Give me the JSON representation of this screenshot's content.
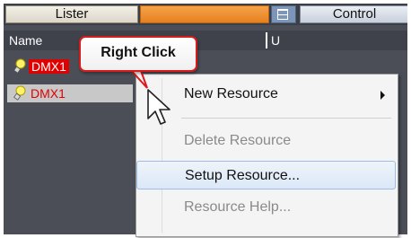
{
  "tabs": {
    "lister": "Lister",
    "control": "Control"
  },
  "columns": {
    "name": "Name",
    "u": "U"
  },
  "rows": [
    {
      "label": "DMX1"
    },
    {
      "label": "DMX1"
    }
  ],
  "menu": {
    "new_resource": "New Resource",
    "delete_resource": "Delete Resource",
    "setup_resource": "Setup Resource...",
    "resource_help": "Resource Help..."
  },
  "callout": {
    "text": "Right Click"
  },
  "colors": {
    "accent_orange": "#e5811f",
    "highlight_red": "#e00000",
    "callout_border": "#d81b1b",
    "menu_hover": "#dbe8f7"
  }
}
